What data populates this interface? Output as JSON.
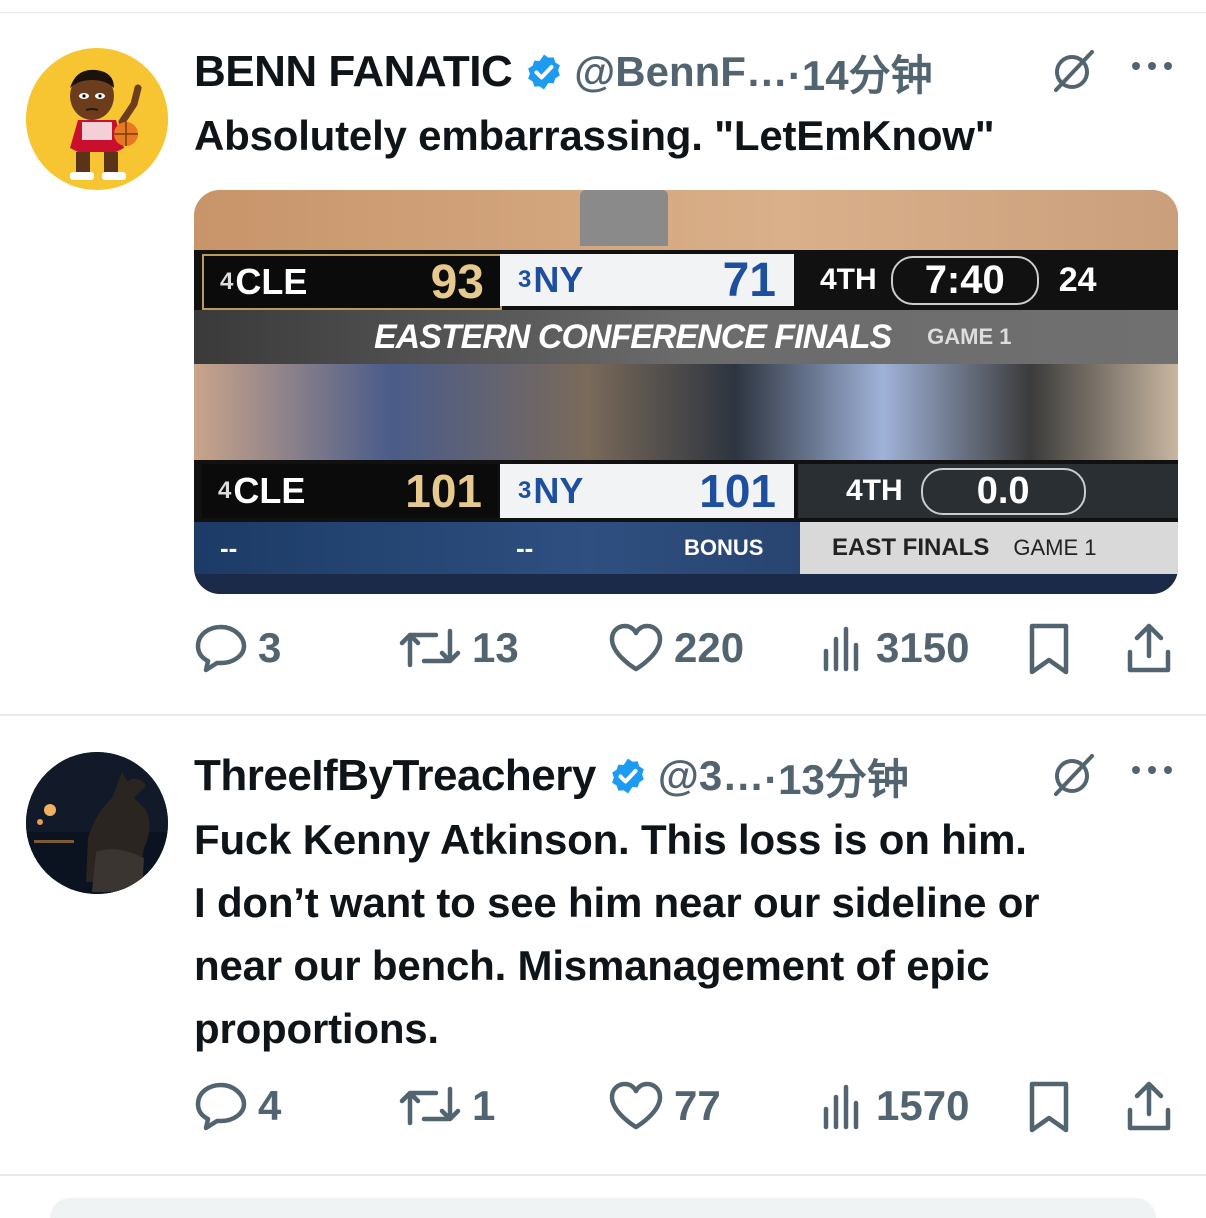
{
  "tweets": [
    {
      "display_name": "BENN FANATIC",
      "handle": "@BennF…",
      "time": "·14分钟",
      "text_lines": [
        "Absolutely embarrassing. \"LetEmKnow\""
      ],
      "stats": {
        "replies": "3",
        "reposts": "13",
        "likes": "220",
        "views": "3150"
      },
      "media": {
        "top_score": {
          "away_seed": "4",
          "away": "CLE",
          "away_score": "93",
          "home_seed": "3",
          "home": "NY",
          "home_score": "71",
          "quarter": "4TH",
          "clock": "7:40",
          "shot_clock": "24"
        },
        "top_banner": {
          "series": "EASTERN CONFERENCE FINALS",
          "game": "GAME 1"
        },
        "bottom_score": {
          "away_seed": "4",
          "away": "CLE",
          "away_score": "101",
          "home_seed": "3",
          "home": "NY",
          "home_score": "101",
          "quarter": "4TH",
          "clock": "0.0"
        },
        "bottom_banner": {
          "away_tol": "--",
          "home_tol": "--",
          "bonus": "BONUS",
          "series": "EAST FINALS",
          "game": "GAME 1"
        }
      }
    },
    {
      "display_name": "ThreeIfByTreachery",
      "handle": "@3…",
      "time": "·13分钟",
      "text_lines": [
        "Fuck Kenny Atkinson.  This loss is on him.",
        "I don’t want to see him near our sideline or",
        "near our bench.  Mismanagement of epic",
        "proportions."
      ],
      "stats": {
        "replies": "4",
        "reposts": "1",
        "likes": "77",
        "views": "1570"
      }
    }
  ],
  "colors": {
    "verified": "#1d9bf0",
    "text": "#0f1419",
    "muted": "#536471",
    "divider": "#e6e8ea"
  },
  "icons": [
    "verified-badge-icon",
    "grok-icon",
    "more-icon",
    "reply-icon",
    "repost-icon",
    "like-icon",
    "views-icon",
    "bookmark-icon",
    "share-icon"
  ]
}
